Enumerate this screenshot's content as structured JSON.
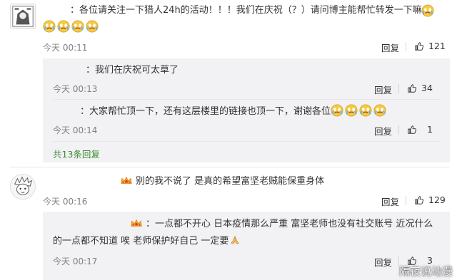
{
  "comments": [
    {
      "text_a": "：各位请关注一下猎人24h的活动！！！我们在庆祝（？）请问博主能帮忙转发一下嘛",
      "time": "今天 00:11",
      "reply_label": "回复",
      "likes": "121",
      "sub_replies": [
        {
          "text": "：我们在庆祝可太草了",
          "time": "今天 00:13",
          "reply_label": "回复",
          "likes": "34"
        },
        {
          "text": "：大家帮忙顶一下，还有这层楼里的链接也顶一下，谢谢各位",
          "time": "今天 00:14",
          "reply_label": "回复",
          "likes": "1"
        }
      ],
      "more_replies": "共13条回复"
    },
    {
      "text": "别的我不说了 是真的希望富坚老贼能保重身体",
      "time": "今天 00:16",
      "reply_label": "回复",
      "likes": "129",
      "sub_replies": [
        {
          "text_line1": "：一点都不开心 日本疫情那么严重 富坚老师也没有社交账号 近况什么",
          "text_line2": "的一点都不知道 唉 老师保护好自己 一定要",
          "time": "今天 00:17",
          "reply_label": "回复",
          "likes": "3"
        }
      ]
    }
  ],
  "watermark": "隔夜说动漫",
  "icons": {
    "emoji": "crying-face-icon",
    "thumb": "thumbs-up-icon",
    "badge": "crown-badge-icon",
    "pray": "praying-hands-icon"
  },
  "colors": {
    "link_green": "#3a8a2e",
    "sub_bg": "#f2f2f5",
    "time_gray": "#808080"
  }
}
